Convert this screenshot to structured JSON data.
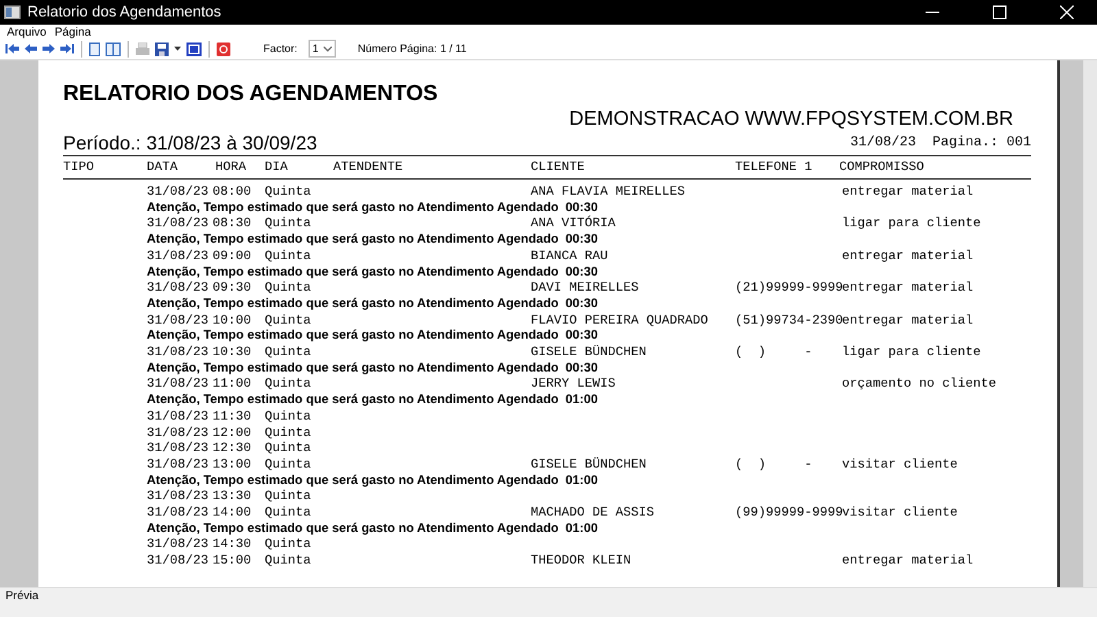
{
  "window": {
    "title": "Relatorio dos Agendamentos"
  },
  "menu": [
    "Arquivo",
    "Página"
  ],
  "toolbar": {
    "factor_label": "Factor:",
    "factor_value": "1",
    "page_label": "Número Página: 1 / 11"
  },
  "report": {
    "title": "RELATORIO DOS AGENDAMENTOS",
    "company": "DEMONSTRACAO WWW.FPQSYSTEM.COM.BR",
    "period": "Período.: 31/08/23 à 30/09/23",
    "print_date": "31/08/23",
    "page": "Pagina.: 001",
    "columns": [
      "TIPO",
      "DATA",
      "HORA",
      "DIA",
      "ATENDENTE",
      "CLIENTE",
      "TELEFONE 1",
      "COMPROMISSO"
    ],
    "rows": [
      {
        "date": "31/08/23",
        "time": "08:00",
        "day": "Quinta",
        "client": "ANA FLAVIA MEIRELLES",
        "phone": "",
        "task": "entregar material",
        "note": "Atenção, Tempo estimado que será gasto no Atendimento Agendado  00:30"
      },
      {
        "date": "31/08/23",
        "time": "08:30",
        "day": "Quinta",
        "client": "ANA VITÓRIA",
        "phone": "",
        "task": "ligar para cliente",
        "note": "Atenção, Tempo estimado que será gasto no Atendimento Agendado  00:30"
      },
      {
        "date": "31/08/23",
        "time": "09:00",
        "day": "Quinta",
        "client": "BIANCA RAU",
        "phone": "",
        "task": "entregar material",
        "note": "Atenção, Tempo estimado que será gasto no Atendimento Agendado  00:30"
      },
      {
        "date": "31/08/23",
        "time": "09:30",
        "day": "Quinta",
        "client": "DAVI MEIRELLES",
        "phone": "(21)99999-9999",
        "task": "entregar material",
        "note": "Atenção, Tempo estimado que será gasto no Atendimento Agendado  00:30"
      },
      {
        "date": "31/08/23",
        "time": "10:00",
        "day": "Quinta",
        "client": "FLAVIO PEREIRA QUADRADO",
        "phone": "(51)99734-2390",
        "task": "entregar material",
        "note": "Atenção, Tempo estimado que será gasto no Atendimento Agendado  00:30"
      },
      {
        "date": "31/08/23",
        "time": "10:30",
        "day": "Quinta",
        "client": "GISELE BÜNDCHEN",
        "phone": "(  )     -",
        "task": "ligar para cliente",
        "note": "Atenção, Tempo estimado que será gasto no Atendimento Agendado  00:30"
      },
      {
        "date": "31/08/23",
        "time": "11:00",
        "day": "Quinta",
        "client": "JERRY LEWIS",
        "phone": "",
        "task": "orçamento no cliente",
        "note": "Atenção, Tempo estimado que será gasto no Atendimento Agendado  01:00"
      },
      {
        "date": "31/08/23",
        "time": "11:30",
        "day": "Quinta",
        "client": "",
        "phone": "",
        "task": "",
        "note": ""
      },
      {
        "date": "31/08/23",
        "time": "12:00",
        "day": "Quinta",
        "client": "",
        "phone": "",
        "task": "",
        "note": ""
      },
      {
        "date": "31/08/23",
        "time": "12:30",
        "day": "Quinta",
        "client": "",
        "phone": "",
        "task": "",
        "note": ""
      },
      {
        "date": "31/08/23",
        "time": "13:00",
        "day": "Quinta",
        "client": "GISELE BÜNDCHEN",
        "phone": "(  )     -",
        "task": "visitar cliente",
        "note": "Atenção, Tempo estimado que será gasto no Atendimento Agendado  01:00"
      },
      {
        "date": "31/08/23",
        "time": "13:30",
        "day": "Quinta",
        "client": "",
        "phone": "",
        "task": "",
        "note": ""
      },
      {
        "date": "31/08/23",
        "time": "14:00",
        "day": "Quinta",
        "client": "MACHADO DE ASSIS",
        "phone": "(99)99999-9999",
        "task": "visitar cliente",
        "note": "Atenção, Tempo estimado que será gasto no Atendimento Agendado  01:00"
      },
      {
        "date": "31/08/23",
        "time": "14:30",
        "day": "Quinta",
        "client": "",
        "phone": "",
        "task": "",
        "note": ""
      },
      {
        "date": "31/08/23",
        "time": "15:00",
        "day": "Quinta",
        "client": "THEODOR KLEIN",
        "phone": "",
        "task": "entregar material",
        "note": ""
      }
    ]
  },
  "status_bar": "Prévia"
}
